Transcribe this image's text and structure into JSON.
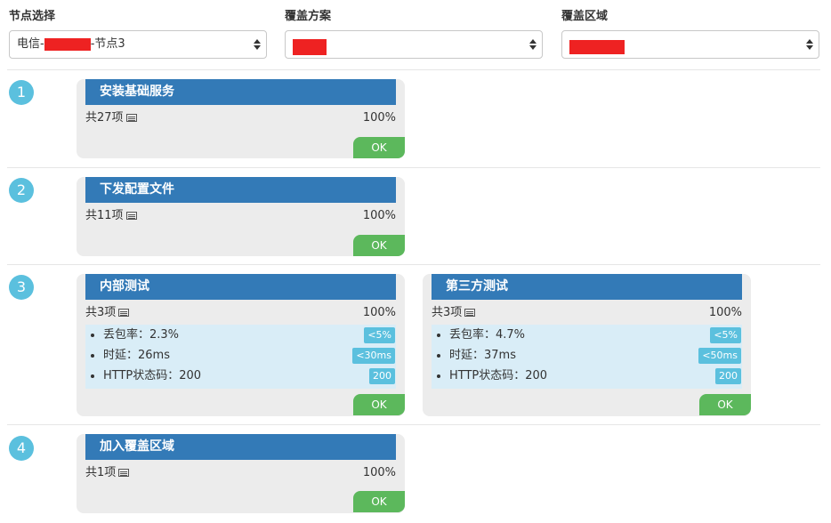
{
  "filters": [
    {
      "label": "节点选择",
      "value_prefix": "电信-",
      "value_suffix": "-节点3"
    },
    {
      "label": "覆盖方案",
      "value_prefix": "",
      "value_suffix": ""
    },
    {
      "label": "覆盖区域",
      "value_prefix": "",
      "value_suffix": ""
    }
  ],
  "steps": [
    {
      "number": "1",
      "cards": [
        {
          "title": "安装基础服务",
          "count": "共27项",
          "percent": "100%",
          "ok": "OK"
        }
      ]
    },
    {
      "number": "2",
      "cards": [
        {
          "title": "下发配置文件",
          "count": "共11项",
          "percent": "100%",
          "ok": "OK"
        }
      ]
    },
    {
      "number": "3",
      "cards": [
        {
          "title": "内部测试",
          "count": "共3项",
          "percent": "100%",
          "ok": "OK",
          "metrics": [
            {
              "text": "丢包率：2.3%",
              "badge": "<5%"
            },
            {
              "text": "时延：26ms",
              "badge": "<30ms"
            },
            {
              "text": "HTTP状态码：200",
              "badge": "200"
            }
          ]
        },
        {
          "title": "第三方测试",
          "count": "共3项",
          "percent": "100%",
          "ok": "OK",
          "metrics": [
            {
              "text": "丢包率：4.7%",
              "badge": "<5%"
            },
            {
              "text": "时延：37ms",
              "badge": "<50ms"
            },
            {
              "text": "HTTP状态码：200",
              "badge": "200"
            }
          ]
        }
      ]
    },
    {
      "number": "4",
      "cards": [
        {
          "title": "加入覆盖区域",
          "count": "共1项",
          "percent": "100%",
          "ok": "OK"
        }
      ]
    }
  ],
  "colors": {
    "step_circle": "#5bc0de",
    "card_title": "#337ab7",
    "ok_button": "#5cb85c",
    "metrics_bg": "#d9edf7",
    "badge": "#5bc0de",
    "redaction": "#ee2222"
  },
  "icons": {
    "count_icon": "list-doc-icon",
    "select_arrows": "up-down-arrows-icon"
  }
}
